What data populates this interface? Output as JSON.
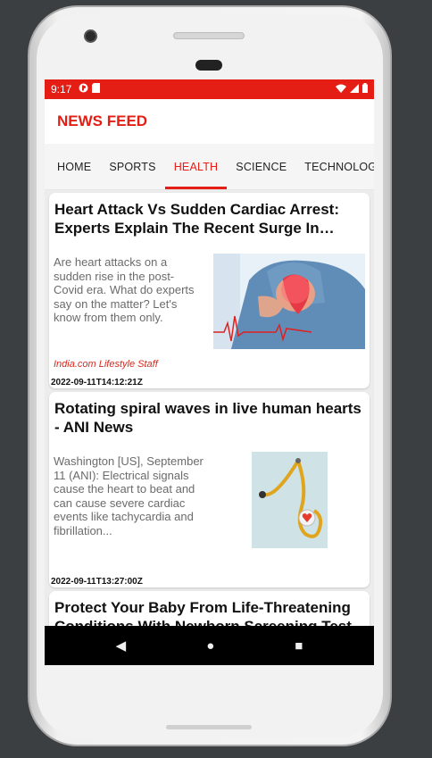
{
  "status_bar": {
    "time": "9:17"
  },
  "app_bar": {
    "title": "NEWS FEED"
  },
  "tabs": [
    {
      "label": "HOME",
      "active": false
    },
    {
      "label": "SPORTS",
      "active": false
    },
    {
      "label": "HEALTH",
      "active": true
    },
    {
      "label": "SCIENCE",
      "active": false
    },
    {
      "label": "TECHNOLOGY",
      "active": false
    }
  ],
  "articles": [
    {
      "title": "Heart Attack Vs Sudden Cardiac Arrest: Experts Explain The Recent Surge In Cases",
      "description": "Are heart attacks on a sudden rise in the post-Covid era. What do experts say on the matter? Let's know from them only.",
      "author": "India.com Lifestyle Staff",
      "published_at": "2022-09-11T14:12:21Z"
    },
    {
      "title": "Rotating spiral waves in live human hearts - ANI News",
      "description": "Washington [US], September 11 (ANI): Electrical signals cause the heart to beat and can cause severe cardiac events like tachycardia and fibrillation...",
      "author": "",
      "published_at": "2022-09-11T13:27:00Z"
    },
    {
      "title": "Protect Your Baby From Life-Threatening Conditions With Newborn Screening Test"
    }
  ],
  "nav": {
    "back": "◀",
    "home": "●",
    "recents": "■"
  },
  "colors": {
    "accent": "#e41e14",
    "byline": "#d32a1f"
  }
}
